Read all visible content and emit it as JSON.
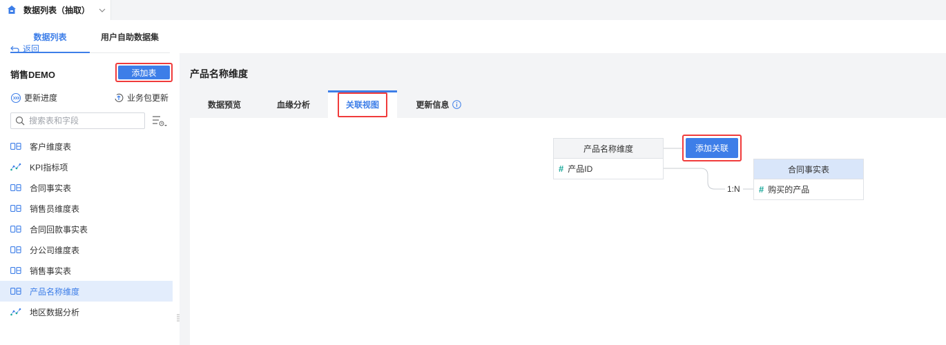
{
  "top_tab": {
    "title": "数据列表（抽取）",
    "home_icon": "home-icon",
    "chevron_icon": "chevron-down-icon"
  },
  "left": {
    "tabs": [
      "数据列表",
      "用户自助数据集"
    ],
    "active_tab": "数据列表",
    "back_label": "返回",
    "package_name": "销售DEMO",
    "add_table_label": "添加表",
    "update_progress_label": "更新进度",
    "business_update_label": "业务包更新",
    "search_placeholder": "搜索表和字段",
    "tables": [
      {
        "name": "客户维度表",
        "icon": "db-icon"
      },
      {
        "name": "KPI指标项",
        "icon": "analysis-icon"
      },
      {
        "name": "合同事实表",
        "icon": "db-icon"
      },
      {
        "name": "销售员维度表",
        "icon": "db-icon"
      },
      {
        "name": "合同回款事实表",
        "icon": "db-icon"
      },
      {
        "name": "分公司维度表",
        "icon": "db-icon"
      },
      {
        "name": "销售事实表",
        "icon": "db-icon"
      },
      {
        "name": "产品名称维度",
        "icon": "db-icon"
      },
      {
        "name": "地区数据分析",
        "icon": "analysis-icon"
      }
    ],
    "selected_table": "产品名称维度"
  },
  "main": {
    "title": "产品名称维度",
    "tabs": [
      "数据预览",
      "血缘分析",
      "关联视图",
      "更新信息"
    ],
    "active_tab": "关联视图",
    "info_icon": "info-icon"
  },
  "relation": {
    "source": {
      "name": "产品名称维度",
      "field": "产品ID"
    },
    "add_relation_label": "添加关联",
    "cardinality": "1:N",
    "target": {
      "name": "合同事实表",
      "field": "购买的产品"
    }
  },
  "colors": {
    "accent": "#3d7ee8",
    "highlight_border": "#f03a3a",
    "field_hash": "#1aa89a",
    "selected_bg": "#e3edfc"
  }
}
